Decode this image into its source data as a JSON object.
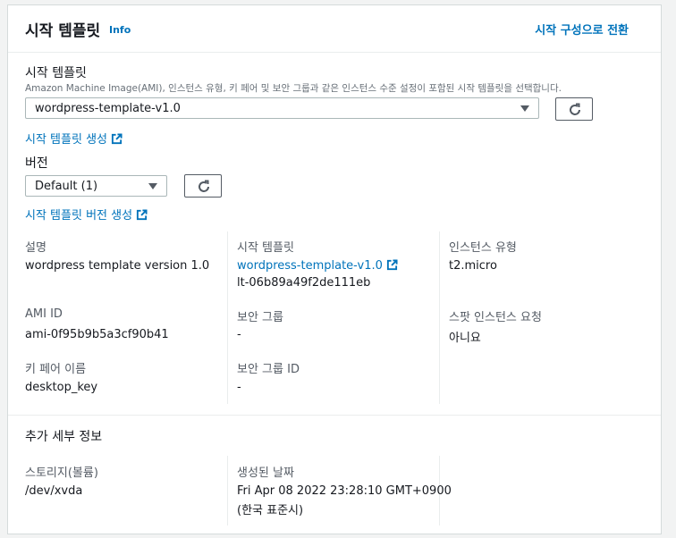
{
  "header": {
    "title": "시작 템플릿",
    "info": "Info",
    "switch_link": "시작 구성으로 전환"
  },
  "template_field": {
    "label": "시작 템플릿",
    "description": "Amazon Machine Image(AMI), 인스턴스 유형, 키 페어 및 보안 그룹과 같은 인스턴스 수준 설정이 포함된 시작 템플릿을 선택합니다.",
    "selected": "wordpress-template-v1.0",
    "create_link": "시작 템플릿 생성"
  },
  "version_field": {
    "label": "버전",
    "selected": "Default (1)",
    "create_link": "시작 템플릿 버전 생성"
  },
  "details": {
    "description": {
      "key": "설명",
      "value": "wordpress template version 1.0"
    },
    "launch_template": {
      "key": "시작 템플릿",
      "link": "wordpress-template-v1.0",
      "id": "lt-06b89a49f2de111eb"
    },
    "instance_type": {
      "key": "인스턴스 유형",
      "value": "t2.micro"
    },
    "ami_id": {
      "key": "AMI ID",
      "value": "ami-0f95b9b5a3cf90b41"
    },
    "security_group": {
      "key": "보안 그룹",
      "value": "-"
    },
    "spot_request": {
      "key": "스팟 인스턴스 요청",
      "value": "아니요"
    },
    "key_pair": {
      "key": "키 페어 이름",
      "value": "desktop_key"
    },
    "security_group_id": {
      "key": "보안 그룹 ID",
      "value": "-"
    }
  },
  "additional": {
    "title": "추가 세부 정보",
    "storage": {
      "key": "스토리지(볼륨)",
      "value": "/dev/xvda"
    },
    "created": {
      "key": "생성된 날짜",
      "value_line1": "Fri Apr 08 2022 23:28:10 GMT+0900",
      "value_line2": "(한국 표준시)"
    }
  },
  "colors": {
    "link": "#0073bb",
    "border": "#aab7b8",
    "muted": "#687078"
  },
  "icons": [
    "refresh-icon",
    "external-link-icon",
    "caret-down-icon"
  ]
}
